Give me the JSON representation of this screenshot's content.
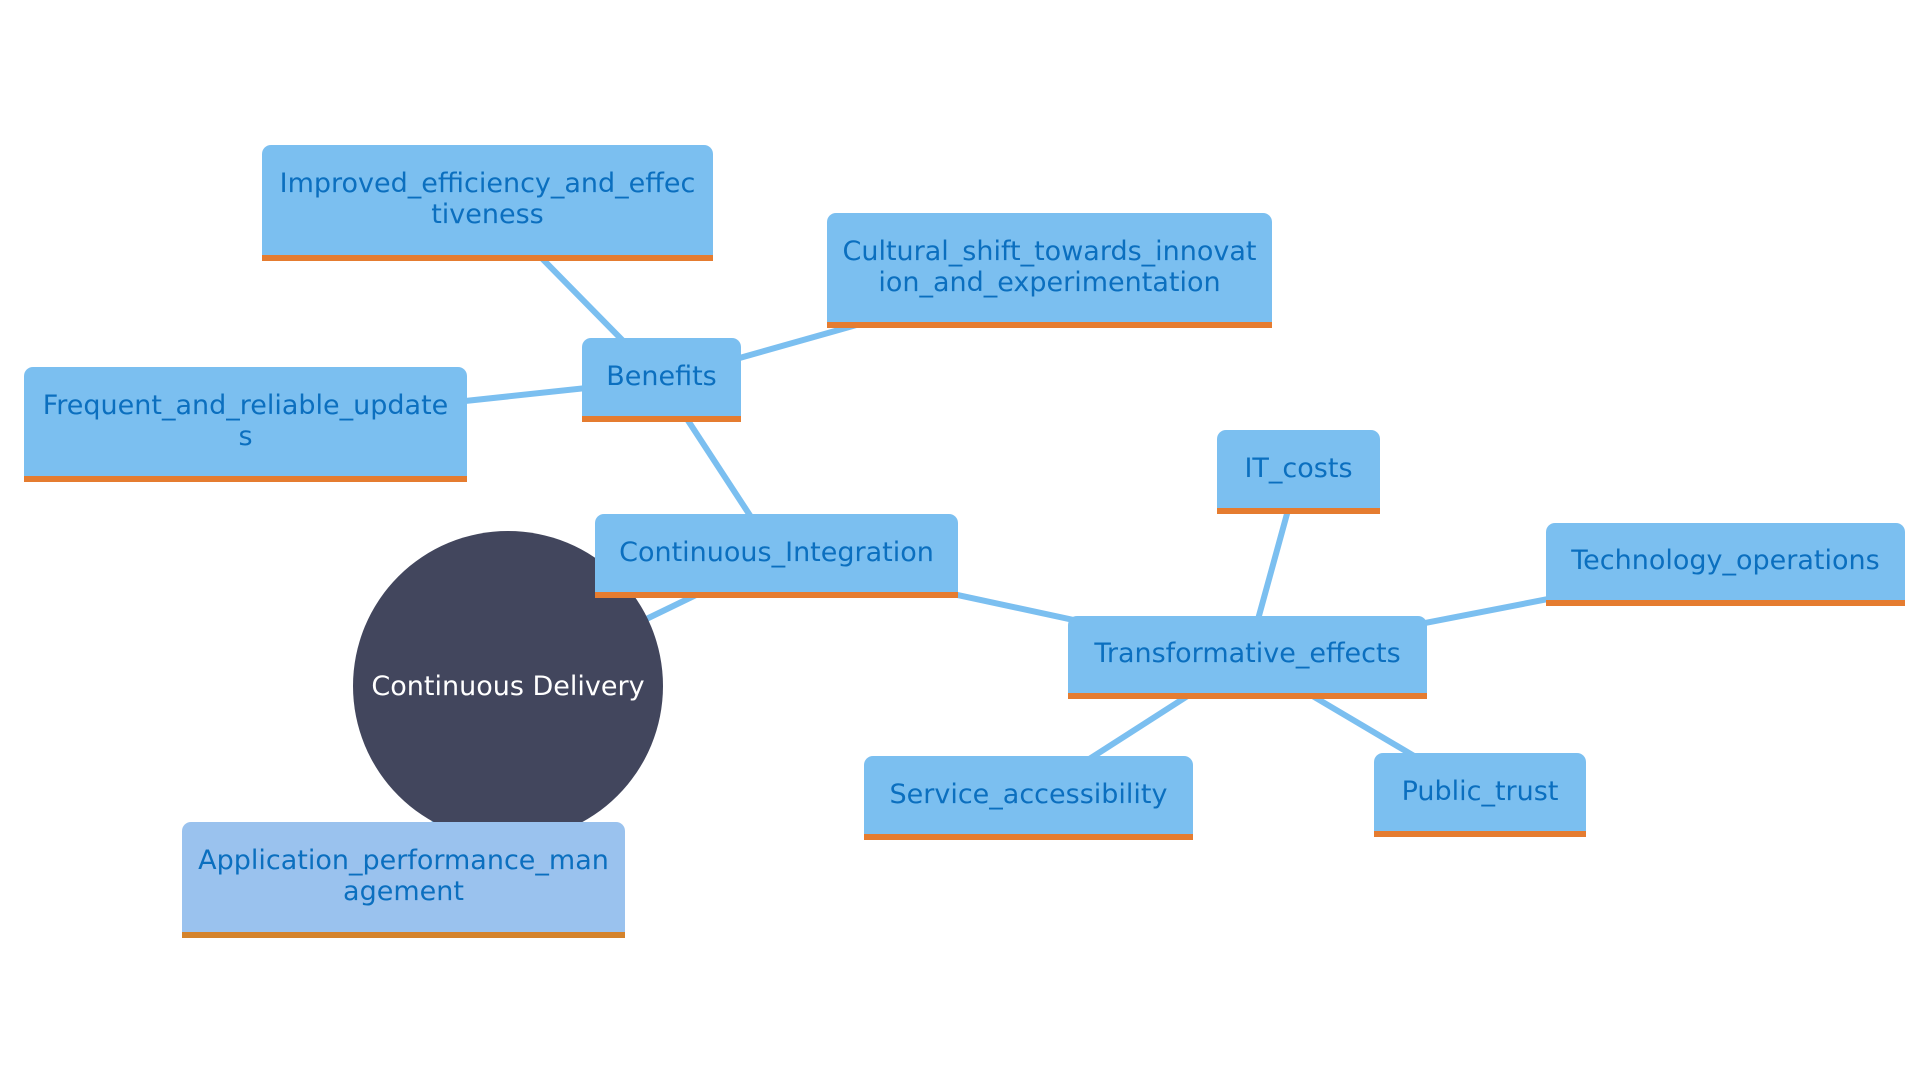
{
  "diagram": {
    "type": "mindmap",
    "colors": {
      "node_fill": "#7bbff0",
      "node_fill_alt": "#9ac2ee",
      "node_text": "#0b6fbf",
      "node_underline": "#e57c30",
      "edge": "#7bbff0",
      "root_fill": "#42465d",
      "root_text": "#ffffff"
    },
    "root": {
      "id": "root",
      "label": "Continuous Delivery"
    },
    "nodes": [
      {
        "id": "ci",
        "label": "Continuous_Integration",
        "parent": "root"
      },
      {
        "id": "benefits",
        "label": "Benefits",
        "parent": "ci"
      },
      {
        "id": "improved",
        "label": "Improved_efficiency_and_effectiveness",
        "parent": "benefits"
      },
      {
        "id": "cultural",
        "label": "Cultural_shift_towards_innovation_and_experimentation",
        "parent": "benefits"
      },
      {
        "id": "frequent",
        "label": "Frequent_and_reliable_updates",
        "parent": "benefits"
      },
      {
        "id": "transformative",
        "label": "Transformative_effects",
        "parent": "ci"
      },
      {
        "id": "itcosts",
        "label": "IT_costs",
        "parent": "transformative"
      },
      {
        "id": "techops",
        "label": "Technology_operations",
        "parent": "transformative"
      },
      {
        "id": "service",
        "label": "Service_accessibility",
        "parent": "transformative"
      },
      {
        "id": "trust",
        "label": "Public_trust",
        "parent": "transformative"
      },
      {
        "id": "apm",
        "label": "Application_performance_management",
        "parent": "root"
      }
    ]
  }
}
